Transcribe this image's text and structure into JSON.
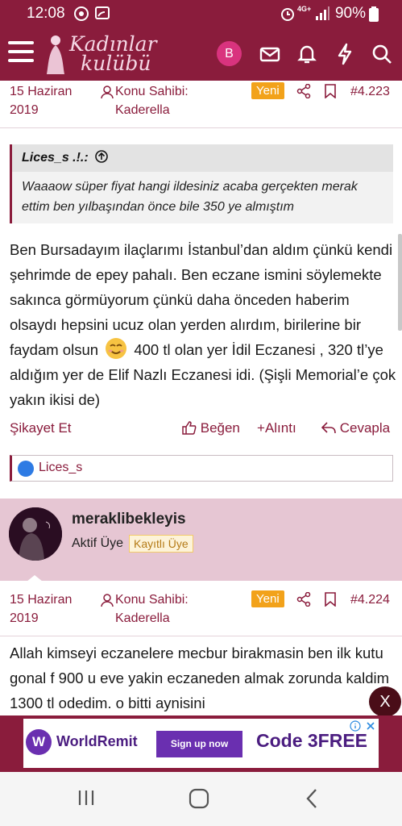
{
  "status_bar": {
    "time": "12:08",
    "network": "4G+",
    "battery": "90%"
  },
  "header": {
    "logo_line1": "Kadınlar",
    "logo_line2": "kulübü",
    "avatar_letter": "B",
    "icons": [
      "envelope-icon",
      "bell-icon",
      "bolt-icon",
      "search-icon"
    ]
  },
  "post1": {
    "date": "15 Haziran 2019",
    "author": "Konu Sahibi: Kaderella",
    "new_badge": "Yeni",
    "post_number": "#4.223",
    "quote": {
      "author": "Lices_s .!.:",
      "text": "Waaaow süper fiyat hangi ildesiniz acaba gerçekten merak ettim ben yılbaşından önce bile 350 ye almıştım"
    },
    "body_before_emoji": "Ben Bursadayım ilaçlarımı İstanbul’dan aldım çünkü kendi şehrimde de epey pahalı. Ben eczane ismini söylemekte sakınca görmüyorum çünkü daha önceden haberim olsaydı hepsini ucuz olan yerden alırdım, birilerine bir faydam olsun",
    "body_after_emoji": "400 tl olan yer İdil Eczanesi , 320 tl’ye aldığım yer de Elif Nazlı Eczanesi idi. (Şişli Memorial’e çok yakın ikisi de)",
    "actions": {
      "report": "Şikayet Et",
      "like": "Beğen",
      "quote": "Alıntı",
      "reply": "Cevapla"
    },
    "liked_by": "Lices_s"
  },
  "user2": {
    "name": "meraklibekleyis",
    "title": "Aktif Üye",
    "badge": "Kayıtlı Üye"
  },
  "post2": {
    "date": "15 Haziran 2019",
    "author": "Konu Sahibi: Kaderella",
    "new_badge": "Yeni",
    "post_number": "#4.224",
    "body": "Allah kimseyi eczanelere mecbur birakmasin ben ilk kutu gonal f 900 u eve yakin eczaneden almak zorunda kaldim 1300 tl odedim. o bitti aynisini"
  },
  "close_label": "X",
  "ad": {
    "brand": "WorldRemit",
    "cta": "Sign up now",
    "promo": "Code 3FREE"
  },
  "colors": {
    "brand": "#8a1c3c",
    "badge_new": "#f2a21a",
    "usercard_bg": "#e6c6d3"
  }
}
